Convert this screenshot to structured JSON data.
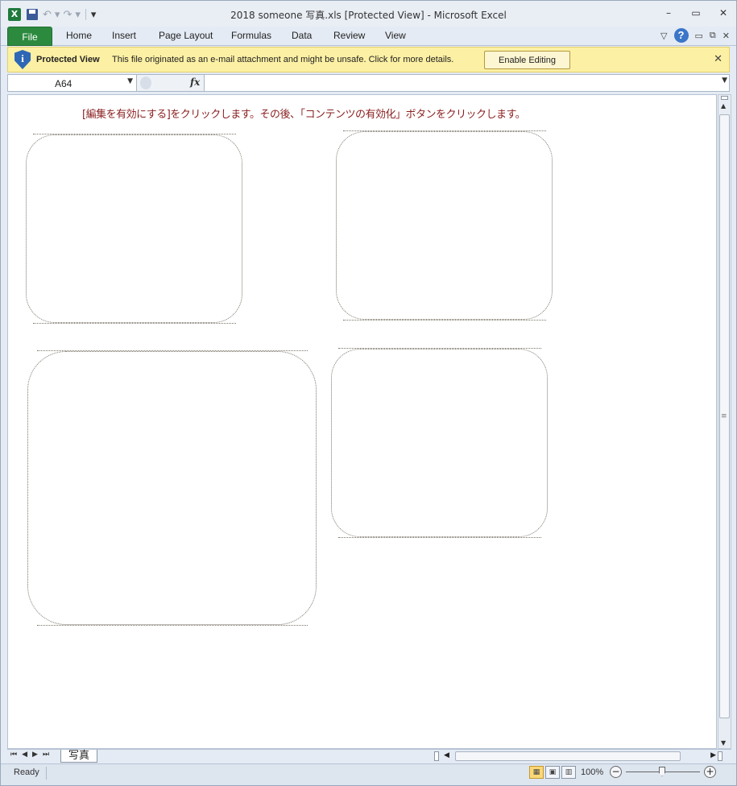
{
  "window": {
    "title": "2018 someone 写真.xls  [Protected View]  -  Microsoft Excel",
    "min_glyph": "▭",
    "restore_glyph": "⧉",
    "close_glyph": "✕"
  },
  "qat": {
    "undo_glyph": "↶",
    "redo_glyph": "↷",
    "more_glyph": "▾"
  },
  "ribbon": {
    "file": "File",
    "tabs": [
      "Home",
      "Insert",
      "Page Layout",
      "Formulas",
      "Data",
      "Review",
      "View"
    ],
    "help": "?"
  },
  "protected_view": {
    "title": "Protected View",
    "message": "This file originated as an e-mail attachment and might be unsafe. Click for more details.",
    "enable_button": "Enable Editing",
    "close": "✕",
    "icon_letter": "i"
  },
  "formula_bar": {
    "name_box": "A64",
    "fx": "fx",
    "formula": ""
  },
  "sheet": {
    "warning_text": "[編集を有効にする]をクリックします。その後、「コンテンツの有効化」ボタンをクリックします。"
  },
  "sheet_tabs": {
    "nav": [
      "⏮",
      "◀",
      "▶",
      "⏭"
    ],
    "active": "写真"
  },
  "status": {
    "ready": "Ready",
    "zoom": "100%",
    "zoom_minus": "−",
    "zoom_plus": "+"
  },
  "colors": {
    "file_tab": "#2c8a3f",
    "protected_bar": "#fcf0a4",
    "warning_text": "#8a1f1f"
  }
}
